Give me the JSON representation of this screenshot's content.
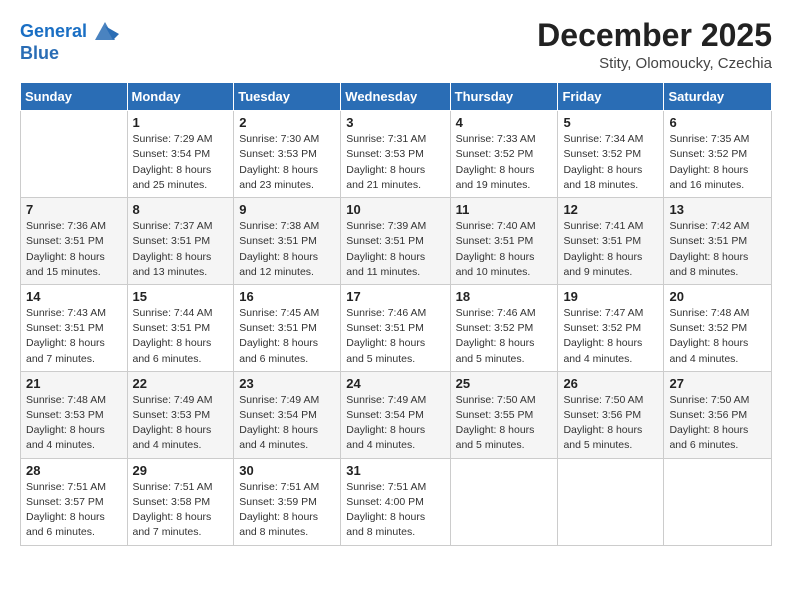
{
  "header": {
    "logo_line1": "General",
    "logo_line2": "Blue",
    "month": "December 2025",
    "location": "Stity, Olomoucky, Czechia"
  },
  "weekdays": [
    "Sunday",
    "Monday",
    "Tuesday",
    "Wednesday",
    "Thursday",
    "Friday",
    "Saturday"
  ],
  "weeks": [
    [
      {
        "day": "",
        "info": ""
      },
      {
        "day": "1",
        "info": "Sunrise: 7:29 AM\nSunset: 3:54 PM\nDaylight: 8 hours\nand 25 minutes."
      },
      {
        "day": "2",
        "info": "Sunrise: 7:30 AM\nSunset: 3:53 PM\nDaylight: 8 hours\nand 23 minutes."
      },
      {
        "day": "3",
        "info": "Sunrise: 7:31 AM\nSunset: 3:53 PM\nDaylight: 8 hours\nand 21 minutes."
      },
      {
        "day": "4",
        "info": "Sunrise: 7:33 AM\nSunset: 3:52 PM\nDaylight: 8 hours\nand 19 minutes."
      },
      {
        "day": "5",
        "info": "Sunrise: 7:34 AM\nSunset: 3:52 PM\nDaylight: 8 hours\nand 18 minutes."
      },
      {
        "day": "6",
        "info": "Sunrise: 7:35 AM\nSunset: 3:52 PM\nDaylight: 8 hours\nand 16 minutes."
      }
    ],
    [
      {
        "day": "7",
        "info": "Sunrise: 7:36 AM\nSunset: 3:51 PM\nDaylight: 8 hours\nand 15 minutes."
      },
      {
        "day": "8",
        "info": "Sunrise: 7:37 AM\nSunset: 3:51 PM\nDaylight: 8 hours\nand 13 minutes."
      },
      {
        "day": "9",
        "info": "Sunrise: 7:38 AM\nSunset: 3:51 PM\nDaylight: 8 hours\nand 12 minutes."
      },
      {
        "day": "10",
        "info": "Sunrise: 7:39 AM\nSunset: 3:51 PM\nDaylight: 8 hours\nand 11 minutes."
      },
      {
        "day": "11",
        "info": "Sunrise: 7:40 AM\nSunset: 3:51 PM\nDaylight: 8 hours\nand 10 minutes."
      },
      {
        "day": "12",
        "info": "Sunrise: 7:41 AM\nSunset: 3:51 PM\nDaylight: 8 hours\nand 9 minutes."
      },
      {
        "day": "13",
        "info": "Sunrise: 7:42 AM\nSunset: 3:51 PM\nDaylight: 8 hours\nand 8 minutes."
      }
    ],
    [
      {
        "day": "14",
        "info": "Sunrise: 7:43 AM\nSunset: 3:51 PM\nDaylight: 8 hours\nand 7 minutes."
      },
      {
        "day": "15",
        "info": "Sunrise: 7:44 AM\nSunset: 3:51 PM\nDaylight: 8 hours\nand 6 minutes."
      },
      {
        "day": "16",
        "info": "Sunrise: 7:45 AM\nSunset: 3:51 PM\nDaylight: 8 hours\nand 6 minutes."
      },
      {
        "day": "17",
        "info": "Sunrise: 7:46 AM\nSunset: 3:51 PM\nDaylight: 8 hours\nand 5 minutes."
      },
      {
        "day": "18",
        "info": "Sunrise: 7:46 AM\nSunset: 3:52 PM\nDaylight: 8 hours\nand 5 minutes."
      },
      {
        "day": "19",
        "info": "Sunrise: 7:47 AM\nSunset: 3:52 PM\nDaylight: 8 hours\nand 4 minutes."
      },
      {
        "day": "20",
        "info": "Sunrise: 7:48 AM\nSunset: 3:52 PM\nDaylight: 8 hours\nand 4 minutes."
      }
    ],
    [
      {
        "day": "21",
        "info": "Sunrise: 7:48 AM\nSunset: 3:53 PM\nDaylight: 8 hours\nand 4 minutes."
      },
      {
        "day": "22",
        "info": "Sunrise: 7:49 AM\nSunset: 3:53 PM\nDaylight: 8 hours\nand 4 minutes."
      },
      {
        "day": "23",
        "info": "Sunrise: 7:49 AM\nSunset: 3:54 PM\nDaylight: 8 hours\nand 4 minutes."
      },
      {
        "day": "24",
        "info": "Sunrise: 7:49 AM\nSunset: 3:54 PM\nDaylight: 8 hours\nand 4 minutes."
      },
      {
        "day": "25",
        "info": "Sunrise: 7:50 AM\nSunset: 3:55 PM\nDaylight: 8 hours\nand 5 minutes."
      },
      {
        "day": "26",
        "info": "Sunrise: 7:50 AM\nSunset: 3:56 PM\nDaylight: 8 hours\nand 5 minutes."
      },
      {
        "day": "27",
        "info": "Sunrise: 7:50 AM\nSunset: 3:56 PM\nDaylight: 8 hours\nand 6 minutes."
      }
    ],
    [
      {
        "day": "28",
        "info": "Sunrise: 7:51 AM\nSunset: 3:57 PM\nDaylight: 8 hours\nand 6 minutes."
      },
      {
        "day": "29",
        "info": "Sunrise: 7:51 AM\nSunset: 3:58 PM\nDaylight: 8 hours\nand 7 minutes."
      },
      {
        "day": "30",
        "info": "Sunrise: 7:51 AM\nSunset: 3:59 PM\nDaylight: 8 hours\nand 8 minutes."
      },
      {
        "day": "31",
        "info": "Sunrise: 7:51 AM\nSunset: 4:00 PM\nDaylight: 8 hours\nand 8 minutes."
      },
      {
        "day": "",
        "info": ""
      },
      {
        "day": "",
        "info": ""
      },
      {
        "day": "",
        "info": ""
      }
    ]
  ]
}
